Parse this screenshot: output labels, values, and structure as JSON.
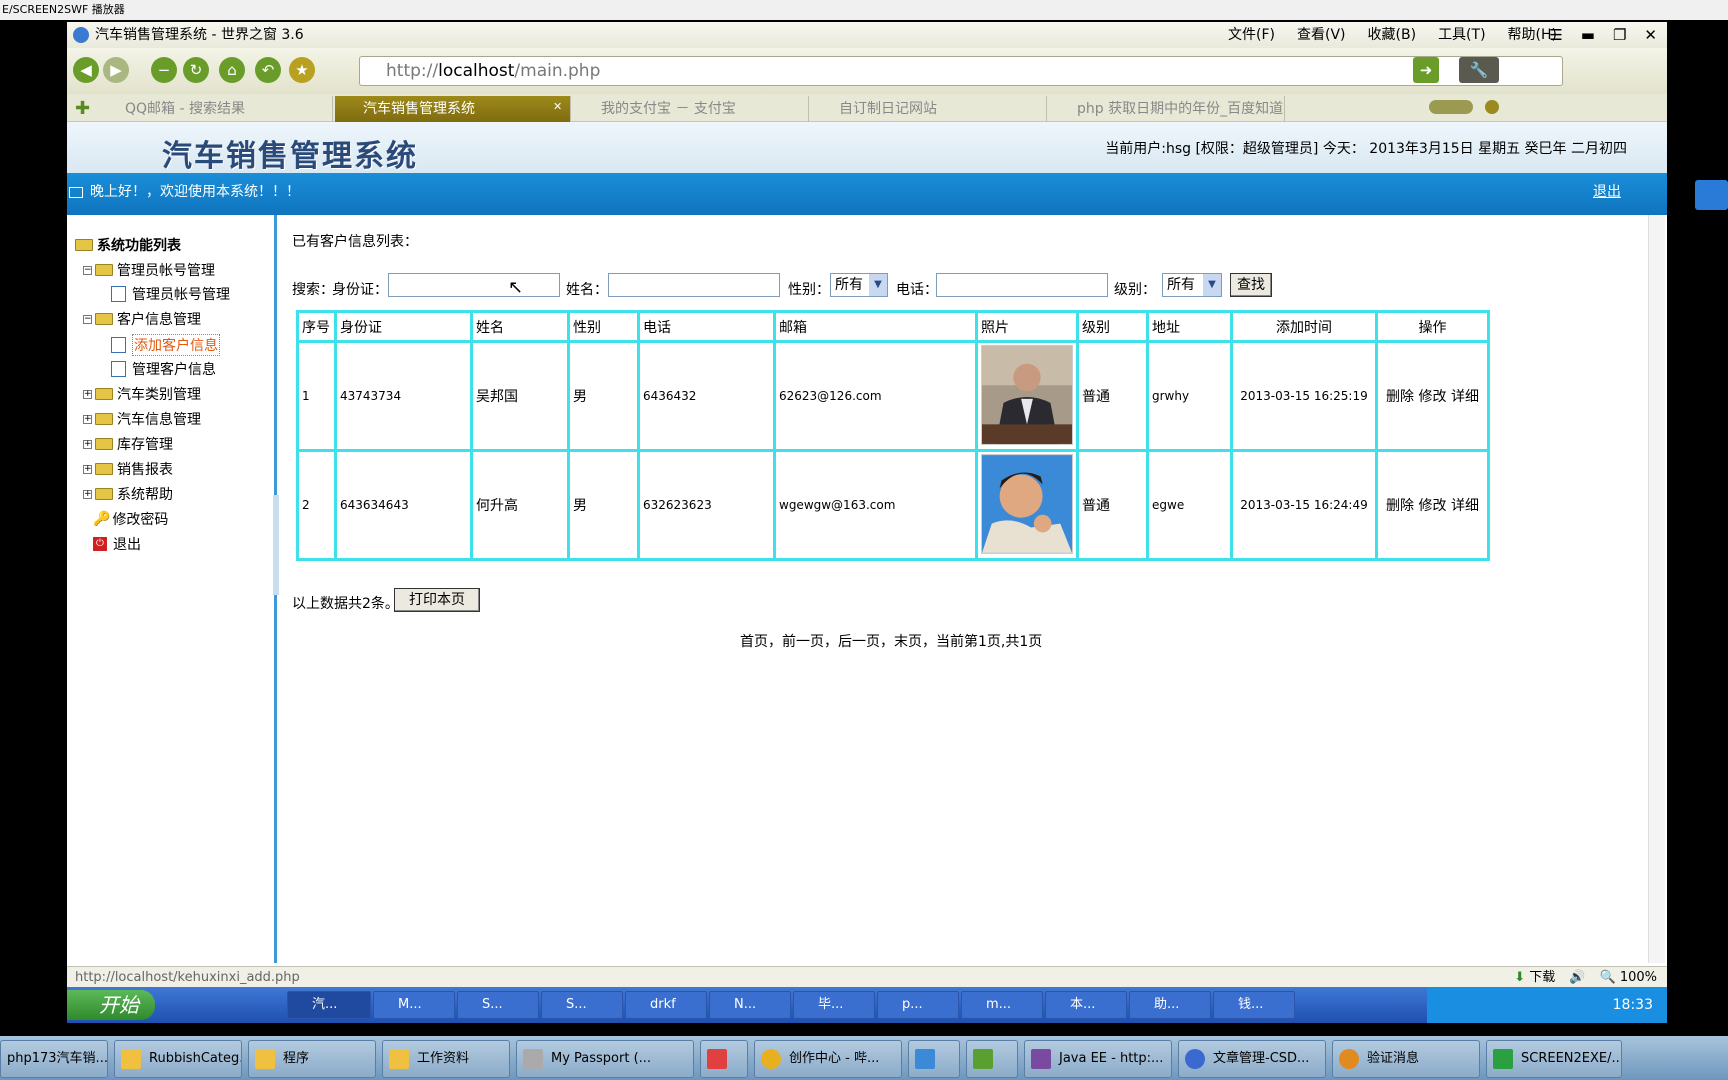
{
  "top_strip": {
    "title": "E/SCREEN2SWF 播放器"
  },
  "browser": {
    "title": "汽车销售管理系统 - 世界之窗 3.6",
    "menus": [
      "文件(F)",
      "查看(V)",
      "收藏(B)",
      "工具(T)",
      "帮助(H)"
    ],
    "url_prefix": "http://",
    "url_host": "localhost",
    "url_path": "/main.php",
    "tabs": [
      {
        "label": "QQ邮箱 - 搜索结果",
        "active": false
      },
      {
        "label": "汽车销售管理系统",
        "active": true
      },
      {
        "label": "我的支付宝 － 支付宝",
        "active": false
      },
      {
        "label": "自订制日记网站",
        "active": false
      },
      {
        "label": "php 获取日期中的年份_百度知道",
        "active": false
      }
    ],
    "status_url": "http://localhost/kehuxinxi_add.php",
    "status_right": {
      "download": "下载",
      "zoom": "100%"
    }
  },
  "header": {
    "system_name": "汽车销售管理系统",
    "user_info": "当前用户:hsg [权限：超级管理员] 今天： 2013年3月15日 星期五 癸巳年 二月初四",
    "greeting": "晚上好！，欢迎使用本系统！！！",
    "logout": "退出"
  },
  "sidebar": {
    "root": "系统功能列表",
    "items": [
      {
        "label": "管理员帐号管理",
        "type": "folder",
        "expanded": true
      },
      {
        "label": "管理员帐号管理",
        "type": "doc"
      },
      {
        "label": "客户信息管理",
        "type": "folder",
        "expanded": true
      },
      {
        "label": "添加客户信息",
        "type": "doc",
        "selected": true
      },
      {
        "label": "管理客户信息",
        "type": "doc"
      },
      {
        "label": "汽车类别管理",
        "type": "folder",
        "expanded": false
      },
      {
        "label": "汽车信息管理",
        "type": "folder",
        "expanded": false
      },
      {
        "label": "库存管理",
        "type": "folder",
        "expanded": false
      },
      {
        "label": "销售报表",
        "type": "folder",
        "expanded": false
      },
      {
        "label": "系统帮助",
        "type": "folder",
        "expanded": false
      },
      {
        "label": "修改密码",
        "type": "key"
      },
      {
        "label": "退出",
        "type": "exit"
      }
    ]
  },
  "main": {
    "list_title": "已有客户信息列表：",
    "search": {
      "search_label": "搜索：",
      "id_label": "身份证：",
      "name_label": "姓名：",
      "gender_label": "性别：",
      "gender_value": "所有",
      "phone_label": "电话：",
      "level_label": "级别：",
      "level_value": "所有",
      "button": "查找"
    },
    "table": {
      "headers": [
        "序号",
        "身份证",
        "姓名",
        "性别",
        "电话",
        "邮箱",
        "照片",
        "级别",
        "地址",
        "添加时间",
        "操作"
      ],
      "rows": [
        {
          "no": "1",
          "id": "43743734",
          "name": "吴邦国",
          "gender": "男",
          "phone": "6436432",
          "email": "62623@126.com",
          "level": "普通",
          "address": "grwhy",
          "time": "2013-03-15 16:25:19",
          "ops": [
            "删除",
            "修改",
            "详细"
          ]
        },
        {
          "no": "2",
          "id": "643634643",
          "name": "何升高",
          "gender": "男",
          "phone": "632623623",
          "email": "wgewgw@163.com",
          "level": "普通",
          "address": "egwe",
          "time": "2013-03-15 16:24:49",
          "ops": [
            "删除",
            "修改",
            "详细"
          ]
        }
      ]
    },
    "total_text": "以上数据共2条。",
    "print_button": "打印本页",
    "pagination": "首页，前一页，后一页，末页，当前第1页,共1页"
  },
  "taskbar_inner": {
    "start": "开始",
    "items": [
      "汽...",
      "M...",
      "S...",
      "S...",
      "drkf",
      "N...",
      "毕...",
      "p...",
      "m...",
      "本...",
      "助...",
      "钱..."
    ],
    "clock": "18:33"
  },
  "taskbar_outer": {
    "items": [
      "php173汽车销...",
      "RubbishCateg...",
      "程序",
      "工作资料",
      "My Passport (...",
      "",
      "创作中心 - 哔...",
      "",
      "",
      "Java EE - http:...",
      "文章管理-CSD...",
      "验证消息",
      "SCREEN2EXE/..."
    ]
  }
}
